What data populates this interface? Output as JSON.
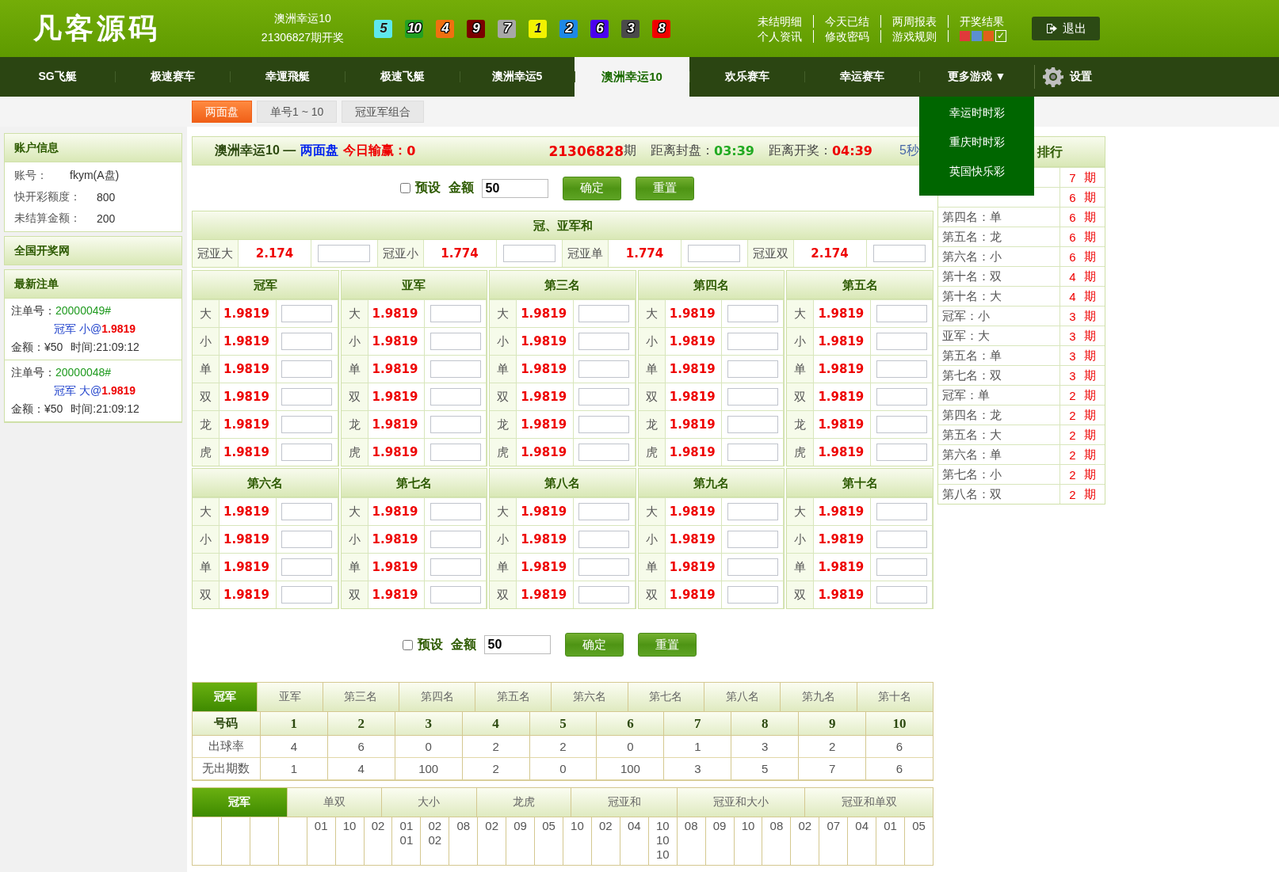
{
  "header": {
    "logo": "凡客源码",
    "lottery": "澳洲幸运10",
    "draw": "21306827期开奖",
    "balls": [
      {
        "number": "5",
        "color": "#5ee8ee"
      },
      {
        "number": "10",
        "color": "#22a022"
      },
      {
        "number": "4",
        "color": "#f07010"
      },
      {
        "number": "9",
        "color": "#7a0000"
      },
      {
        "number": "7",
        "color": "#a8a8a8"
      },
      {
        "number": "1",
        "color": "#f2f200"
      },
      {
        "number": "2",
        "color": "#1e88e5"
      },
      {
        "number": "6",
        "color": "#4a00f0"
      },
      {
        "number": "3",
        "color": "#4a4a4a"
      },
      {
        "number": "8",
        "color": "#f00000"
      }
    ],
    "links": [
      [
        "未结明细",
        "今天已结",
        "两周报表",
        "开奖结果"
      ],
      [
        "个人资讯",
        "修改密码",
        "游戏规则"
      ]
    ],
    "themes": [
      {
        "color": "#e03a3a"
      },
      {
        "color": "#5b8fd0"
      },
      {
        "color": "#e0601a"
      }
    ],
    "theme_check": "✓",
    "logout": "退出"
  },
  "nav": {
    "items": [
      {
        "label": "SG飞艇",
        "selected": false
      },
      {
        "label": "极速赛车",
        "selected": false
      },
      {
        "label": "幸運飛艇",
        "selected": false
      },
      {
        "label": "极速飞艇",
        "selected": false
      },
      {
        "label": "澳洲幸运5",
        "selected": false
      },
      {
        "label": "澳洲幸运10",
        "selected": true
      },
      {
        "label": "欢乐赛车",
        "selected": false
      },
      {
        "label": "幸运赛车",
        "selected": false
      },
      {
        "label": "更多游戏 ▼",
        "selected": false
      }
    ],
    "settings": "设置",
    "dropdown": [
      "幸运时时彩",
      "重庆时时彩",
      "英国快乐彩"
    ]
  },
  "subtabs": [
    {
      "label": "两面盘",
      "selected": true
    },
    {
      "label": "单号1 ~ 10",
      "selected": false
    },
    {
      "label": "冠亚军组合",
      "selected": false
    }
  ],
  "sidebar": {
    "account": {
      "title": "账户信息",
      "rows": [
        {
          "label": "账号：",
          "value": "fkym(A盘)"
        },
        {
          "label": "快开彩额度：",
          "value": "800"
        },
        {
          "label": "未结算金额：",
          "value": "200"
        }
      ]
    },
    "link": "全国开奖网",
    "bets": {
      "title": "最新注单",
      "items": [
        {
          "number_label": "注单号：",
          "number": "20000049#",
          "position": "冠军",
          "pick": "小@",
          "odds": "1.9819",
          "amount": "金额：¥50",
          "time": "时间:21:09:12"
        },
        {
          "number_label": "注单号：",
          "number": "20000048#",
          "position": "冠军",
          "pick": "大@",
          "odds": "1.9819",
          "amount": "金额：¥50",
          "time": "时间:21:09:12"
        }
      ]
    }
  },
  "title_bar": {
    "game": "澳洲幸运10 —",
    "mode": "两面盘",
    "profit_label": "今日输赢：",
    "profit": "0",
    "period": "21306828",
    "period_unit": "期",
    "close_label": "距离封盘：",
    "close_time": "03:39",
    "draw_label": "距离开奖：",
    "draw_time": "04:39",
    "refresh": "5秒"
  },
  "preset_rows": [
    {
      "checked": false,
      "label": "预设",
      "amount_label": "金额",
      "amount": "50",
      "confirm": "确定",
      "reset": "重置"
    },
    {
      "checked": false,
      "label": "预设",
      "amount_label": "金额",
      "amount": "50",
      "confirm": "确定",
      "reset": "重置"
    }
  ],
  "sum_section": {
    "title": "冠、亚军和",
    "items": [
      {
        "label": "冠亚大",
        "odds": "2.174"
      },
      {
        "label": "冠亚小",
        "odds": "1.774"
      },
      {
        "label": "冠亚单",
        "odds": "1.774"
      },
      {
        "label": "冠亚双",
        "odds": "2.174"
      }
    ]
  },
  "positions": [
    {
      "name": "冠军",
      "options": [
        {
          "label": "大",
          "odds": "1.9819"
        },
        {
          "label": "小",
          "odds": "1.9819"
        },
        {
          "label": "单",
          "odds": "1.9819"
        },
        {
          "label": "双",
          "odds": "1.9819"
        },
        {
          "label": "龙",
          "odds": "1.9819"
        },
        {
          "label": "虎",
          "odds": "1.9819"
        }
      ]
    },
    {
      "name": "亚军",
      "options": [
        {
          "label": "大",
          "odds": "1.9819"
        },
        {
          "label": "小",
          "odds": "1.9819"
        },
        {
          "label": "单",
          "odds": "1.9819"
        },
        {
          "label": "双",
          "odds": "1.9819"
        },
        {
          "label": "龙",
          "odds": "1.9819"
        },
        {
          "label": "虎",
          "odds": "1.9819"
        }
      ]
    },
    {
      "name": "第三名",
      "options": [
        {
          "label": "大",
          "odds": "1.9819"
        },
        {
          "label": "小",
          "odds": "1.9819"
        },
        {
          "label": "单",
          "odds": "1.9819"
        },
        {
          "label": "双",
          "odds": "1.9819"
        },
        {
          "label": "龙",
          "odds": "1.9819"
        },
        {
          "label": "虎",
          "odds": "1.9819"
        }
      ]
    },
    {
      "name": "第四名",
      "options": [
        {
          "label": "大",
          "odds": "1.9819"
        },
        {
          "label": "小",
          "odds": "1.9819"
        },
        {
          "label": "单",
          "odds": "1.9819"
        },
        {
          "label": "双",
          "odds": "1.9819"
        },
        {
          "label": "龙",
          "odds": "1.9819"
        },
        {
          "label": "虎",
          "odds": "1.9819"
        }
      ]
    },
    {
      "name": "第五名",
      "options": [
        {
          "label": "大",
          "odds": "1.9819"
        },
        {
          "label": "小",
          "odds": "1.9819"
        },
        {
          "label": "单",
          "odds": "1.9819"
        },
        {
          "label": "双",
          "odds": "1.9819"
        },
        {
          "label": "龙",
          "odds": "1.9819"
        },
        {
          "label": "虎",
          "odds": "1.9819"
        }
      ]
    },
    {
      "name": "第六名",
      "options": [
        {
          "label": "大",
          "odds": "1.9819"
        },
        {
          "label": "小",
          "odds": "1.9819"
        },
        {
          "label": "单",
          "odds": "1.9819"
        },
        {
          "label": "双",
          "odds": "1.9819"
        }
      ]
    },
    {
      "name": "第七名",
      "options": [
        {
          "label": "大",
          "odds": "1.9819"
        },
        {
          "label": "小",
          "odds": "1.9819"
        },
        {
          "label": "单",
          "odds": "1.9819"
        },
        {
          "label": "双",
          "odds": "1.9819"
        }
      ]
    },
    {
      "name": "第八名",
      "options": [
        {
          "label": "大",
          "odds": "1.9819"
        },
        {
          "label": "小",
          "odds": "1.9819"
        },
        {
          "label": "单",
          "odds": "1.9819"
        },
        {
          "label": "双",
          "odds": "1.9819"
        }
      ]
    },
    {
      "name": "第九名",
      "options": [
        {
          "label": "大",
          "odds": "1.9819"
        },
        {
          "label": "小",
          "odds": "1.9819"
        },
        {
          "label": "单",
          "odds": "1.9819"
        },
        {
          "label": "双",
          "odds": "1.9819"
        }
      ]
    },
    {
      "name": "第十名",
      "options": [
        {
          "label": "大",
          "odds": "1.9819"
        },
        {
          "label": "小",
          "odds": "1.9819"
        },
        {
          "label": "单",
          "odds": "1.9819"
        },
        {
          "label": "双",
          "odds": "1.9819"
        }
      ]
    }
  ],
  "ranking": {
    "title": "排行",
    "rows": [
      {
        "count": "7",
        "unit": "期"
      },
      {
        "count": "6",
        "unit": "期"
      },
      {
        "label": "第四名：单",
        "count": "6",
        "unit": "期"
      },
      {
        "label": "第五名：龙",
        "count": "6",
        "unit": "期"
      },
      {
        "label": "第六名：小",
        "count": "6",
        "unit": "期"
      },
      {
        "label": "第十名：双",
        "count": "4",
        "unit": "期"
      },
      {
        "label": "第十名：大",
        "count": "4",
        "unit": "期"
      },
      {
        "label": "冠军：小",
        "count": "3",
        "unit": "期"
      },
      {
        "label": "亚军：大",
        "count": "3",
        "unit": "期"
      },
      {
        "label": "第五名：单",
        "count": "3",
        "unit": "期"
      },
      {
        "label": "第七名：双",
        "count": "3",
        "unit": "期"
      },
      {
        "label": "冠军：单",
        "count": "2",
        "unit": "期"
      },
      {
        "label": "第四名：龙",
        "count": "2",
        "unit": "期"
      },
      {
        "label": "第五名：大",
        "count": "2",
        "unit": "期"
      },
      {
        "label": "第六名：单",
        "count": "2",
        "unit": "期"
      },
      {
        "label": "第七名：小",
        "count": "2",
        "unit": "期"
      },
      {
        "label": "第八名：双",
        "count": "2",
        "unit": "期"
      }
    ]
  },
  "stats": {
    "tabs": [
      {
        "label": "冠军",
        "selected": true
      },
      {
        "label": "亚军",
        "selected": false
      },
      {
        "label": "第三名",
        "selected": false
      },
      {
        "label": "第四名",
        "selected": false
      },
      {
        "label": "第五名",
        "selected": false
      },
      {
        "label": "第六名",
        "selected": false
      },
      {
        "label": "第七名",
        "selected": false
      },
      {
        "label": "第八名",
        "selected": false
      },
      {
        "label": "第九名",
        "selected": false
      },
      {
        "label": "第十名",
        "selected": false
      }
    ],
    "header": [
      "号码",
      "1",
      "2",
      "3",
      "4",
      "5",
      "6",
      "7",
      "8",
      "9",
      "10"
    ],
    "rows": [
      [
        "出球率",
        "4",
        "6",
        "0",
        "2",
        "2",
        "0",
        "1",
        "3",
        "2",
        "6"
      ],
      [
        "无出期数",
        "1",
        "4",
        "100",
        "2",
        "0",
        "100",
        "3",
        "5",
        "7",
        "6"
      ]
    ]
  },
  "trend": {
    "tabs": [
      {
        "label": "冠军",
        "selected": true
      },
      {
        "label": "单双",
        "selected": false
      },
      {
        "label": "大小",
        "selected": false
      },
      {
        "label": "龙虎",
        "selected": false
      },
      {
        "label": "冠亚和",
        "selected": false
      },
      {
        "label": "冠亚和大小",
        "selected": false
      },
      {
        "label": "冠亚和单双",
        "selected": false
      }
    ],
    "cells": [
      {
        "kind": "empty"
      },
      {
        "kind": "empty"
      },
      {
        "kind": "empty"
      },
      {
        "kind": "empty"
      },
      {
        "kind": "numbers",
        "lines": [
          "01"
        ]
      },
      {
        "kind": "numbers",
        "lines": [
          "10"
        ]
      },
      {
        "kind": "numbers",
        "lines": [
          "02"
        ]
      },
      {
        "kind": "numbers",
        "lines": [
          "01",
          "01"
        ]
      },
      {
        "kind": "numbers",
        "lines": [
          "02",
          "02"
        ]
      },
      {
        "kind": "numbers",
        "lines": [
          "08"
        ]
      },
      {
        "kind": "numbers",
        "lines": [
          "02"
        ]
      },
      {
        "kind": "numbers",
        "lines": [
          "09"
        ]
      },
      {
        "kind": "numbers",
        "lines": [
          "05"
        ]
      },
      {
        "kind": "numbers",
        "lines": [
          "10"
        ]
      },
      {
        "kind": "numbers",
        "lines": [
          "02"
        ]
      },
      {
        "kind": "numbers",
        "lines": [
          "04"
        ]
      },
      {
        "kind": "numbers",
        "lines": [
          "10",
          "10",
          "10"
        ]
      },
      {
        "kind": "numbers",
        "lines": [
          "08"
        ]
      },
      {
        "kind": "numbers",
        "lines": [
          "09"
        ]
      },
      {
        "kind": "numbers",
        "lines": [
          "10"
        ]
      },
      {
        "kind": "numbers",
        "lines": [
          "08"
        ]
      },
      {
        "kind": "numbers",
        "lines": [
          "02"
        ]
      },
      {
        "kind": "numbers",
        "lines": [
          "07"
        ]
      },
      {
        "kind": "numbers",
        "lines": [
          "04"
        ]
      },
      {
        "kind": "numbers",
        "lines": [
          "01"
        ]
      },
      {
        "kind": "numbers",
        "lines": [
          "05"
        ]
      }
    ]
  }
}
